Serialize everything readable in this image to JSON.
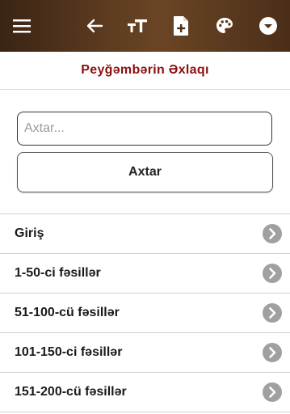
{
  "appbar": {
    "icons": [
      "menu-icon",
      "arrow-left-icon",
      "text-size-icon",
      "add-document-icon",
      "palette-icon",
      "chevron-down-circle-icon"
    ]
  },
  "page": {
    "title": "Peyğəmbərin Əxlaqı"
  },
  "search": {
    "placeholder": "Axtar...",
    "value": "",
    "button_label": "Axtar"
  },
  "chapters": [
    {
      "label": "Giriş"
    },
    {
      "label": "1-50-ci fəsillər"
    },
    {
      "label": "51-100-cü fəsillər"
    },
    {
      "label": "101-150-ci fəsillər"
    },
    {
      "label": "151-200-cü fəsillər"
    }
  ],
  "colors": {
    "title": "#8b0f0f",
    "appbar_dark": "#3a2414",
    "appbar_light": "#6a4525",
    "chevron_circle": "#a0a0a0"
  }
}
